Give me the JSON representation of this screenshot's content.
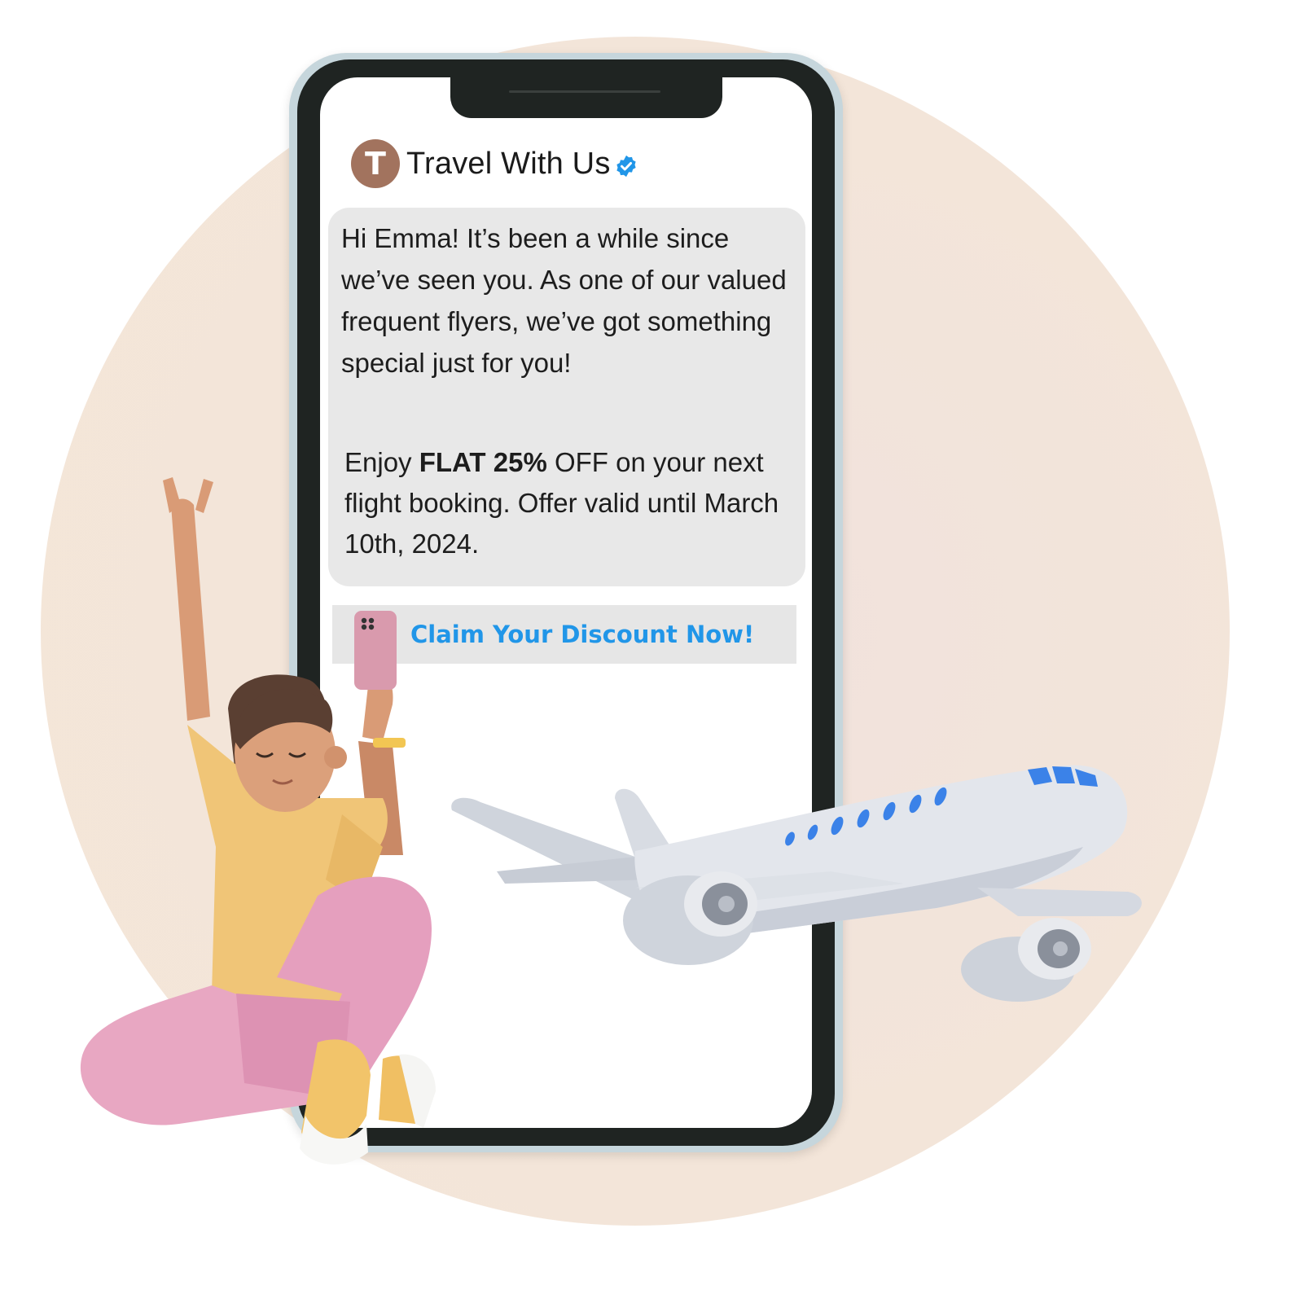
{
  "colors": {
    "background_circle": "#f3e5da",
    "avatar": "#a2735e",
    "bubble": "#e8e8e8",
    "cta_text": "#2196e8",
    "verified_badge": "#2196e8"
  },
  "sender": {
    "avatar_letter": "T",
    "name": "Travel With Us",
    "verified_icon": "verified-badge-icon"
  },
  "message": {
    "paragraph1": "Hi Emma! It’s been a while since we’ve seen you. As one of our valued frequent flyers, we’ve got something special just for you!",
    "paragraph2": {
      "prefix": "Enjoy ",
      "highlight": "FLAT 25%",
      "suffix": " OFF on your next flight booking. Offer valid until March 10th, 2024."
    }
  },
  "cta": {
    "label": "Claim Your Discount Now!"
  },
  "illustrations": {
    "woman": "woman-with-phone-illustration",
    "plane": "airplane-illustration"
  }
}
